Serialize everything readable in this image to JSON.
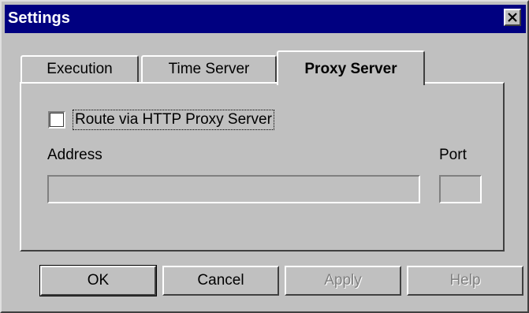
{
  "window": {
    "title": "Settings",
    "close_icon": "close-icon"
  },
  "tabs": [
    {
      "label": "Execution",
      "active": false
    },
    {
      "label": "Time Server",
      "active": false
    },
    {
      "label": "Proxy Server",
      "active": true
    }
  ],
  "proxy": {
    "checkbox_label": "Route via HTTP Proxy Server",
    "checkbox_checked": false,
    "address_label": "Address",
    "address_value": "",
    "port_label": "Port",
    "port_value": ""
  },
  "buttons": {
    "ok": "OK",
    "cancel": "Cancel",
    "apply": "Apply",
    "help": "Help"
  },
  "colors": {
    "titlebar": "#000080",
    "face": "#c0c0c0",
    "disabled_text": "#808080"
  }
}
